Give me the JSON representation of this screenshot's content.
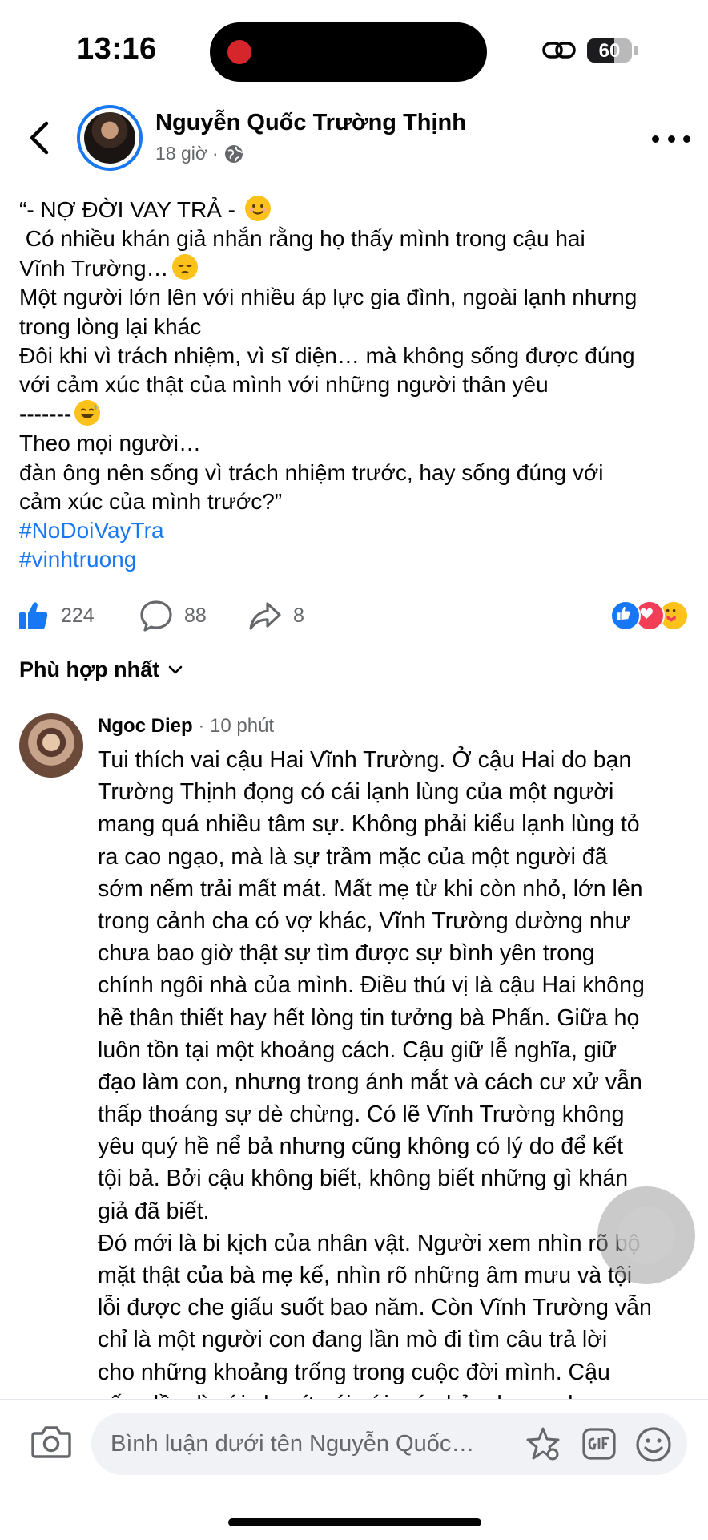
{
  "status_bar": {
    "time": "13:16",
    "battery_text": "60",
    "battery_level": 0.6
  },
  "post": {
    "author": "Nguyễn Quốc Trường Thịnh",
    "time": "18 giờ",
    "separator": "·",
    "privacy_icon": "globe-icon",
    "lines": [
      {
        "text": "“- NỢ ĐỜI VAY TRẢ - ",
        "emoji": "smiling-face"
      },
      {
        "text": " Có nhiều khán giả nhắn rằng họ thấy mình trong cậu hai"
      },
      {
        "text": "Vĩnh Trường…",
        "emoji": "pensive-face"
      },
      {
        "text": "Một người lớn lên với nhiều áp lực gia đình, ngoài lạnh nhưng"
      },
      {
        "text": "trong lòng lại khác"
      },
      {
        "text": "Đôi khi vì trách nhiệm, vì sĩ diện… mà không sống được đúng"
      },
      {
        "text": "với cảm xúc thật của mình với những người thân yêu"
      },
      {
        "text": "-------",
        "emoji": "sweat-smile-face"
      },
      {
        "text": "Theo mọi người…"
      },
      {
        "text": "đàn ông nên sống vì trách nhiệm trước, hay sống đúng với"
      },
      {
        "text": "cảm xúc của mình trước?”"
      }
    ],
    "hashtags": [
      "#NoDoiVayTra",
      "#vinhtruong"
    ],
    "likes": "224",
    "comments": "88",
    "shares": "8",
    "reactions": [
      "like",
      "love",
      "care"
    ]
  },
  "sort": {
    "label": "Phù hợp nhất"
  },
  "comment": {
    "author": "Ngoc Diep",
    "time": "· 10 phút",
    "lines": [
      "Tui thích vai cậu Hai Vĩnh Trường. Ở cậu Hai do bạn",
      "Trường Thịnh đọng có cái lạnh lùng của một người",
      "mang quá nhiều tâm sự. Không phải kiểu lạnh lùng tỏ",
      "ra cao ngạo, mà là sự trầm mặc của một người đã",
      "sớm nếm trải mất mát. Mất mẹ từ khi còn nhỏ, lớn lên",
      "trong cảnh cha có vợ khác, Vĩnh Trường dường như",
      "chưa bao giờ thật sự tìm được sự bình yên trong",
      "chính ngôi nhà của mình. Điều thú vị là cậu Hai không",
      "hề thân thiết hay hết lòng tin tưởng bà Phấn. Giữa họ",
      "luôn tồn tại một khoảng cách. Cậu giữ lễ nghĩa, giữ",
      "đạo làm con, nhưng trong ánh mắt và cách cư xử vẫn",
      "thấp thoáng sự dè chừng. Có lẽ Vĩnh Trường không",
      "yêu quý hề nể bả nhưng cũng không có lý do để kết",
      "tội bả. Bởi cậu không biết, không biết những gì khán",
      "giả đã biết.",
      "Đó mới là bi kịch của nhân vật. Người xem nhìn rõ bộ",
      "mặt thật của bà mẹ kế, nhìn rõ những âm mưu và tội",
      "lỗi được che giấu suốt bao năm. Còn Vĩnh Trường vẫn",
      "chỉ là một người con đang lần mò đi tìm câu trả lời",
      "cho những khoảng trống trong cuộc đời mình. Cậu",
      "sống lầm lì với cha, ít nói với má ghẻ, nhưng chưa"
    ]
  },
  "composer": {
    "placeholder": "Bình luận dưới tên Nguyễn Quốc…"
  },
  "colors": {
    "accent": "#1877f2",
    "secondary_text": "#65676b"
  }
}
